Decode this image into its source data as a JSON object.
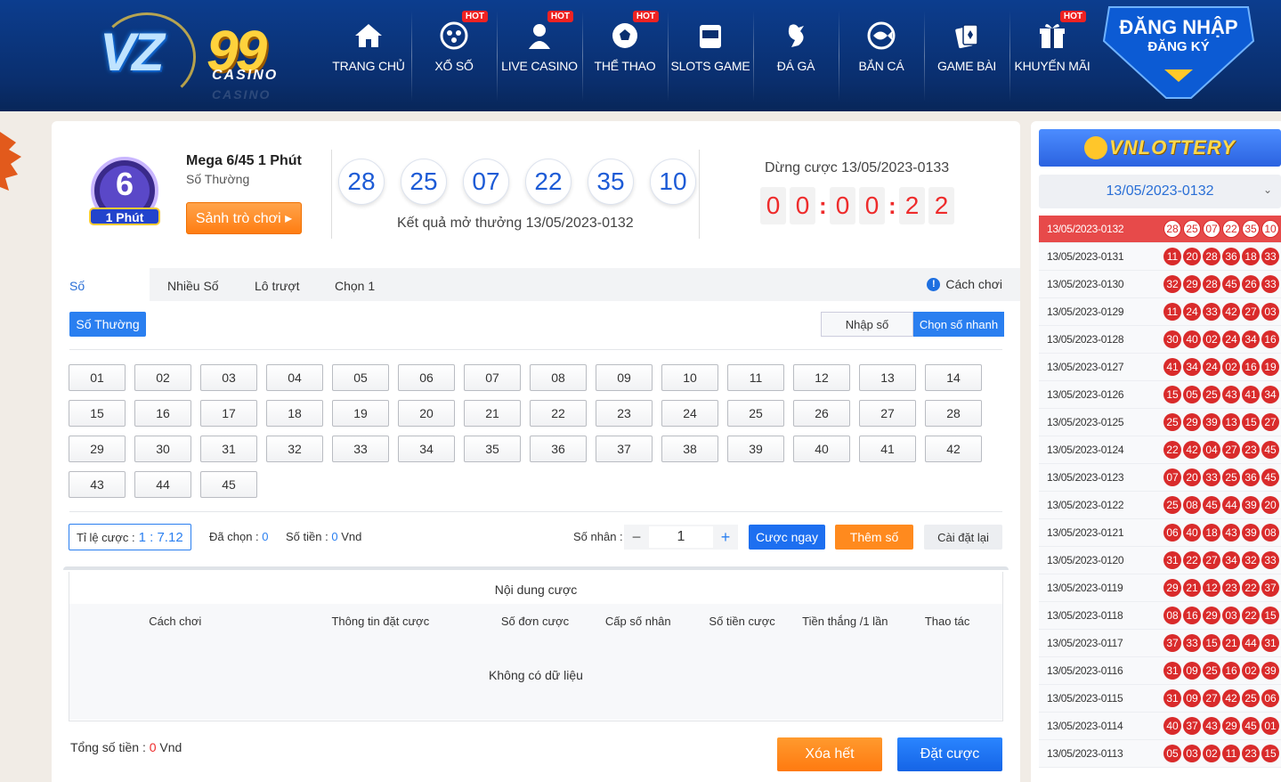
{
  "header": {
    "logo_text": "VZ99",
    "logo_sub": "CASINO",
    "nav": [
      {
        "label": "TRANG CHỦ",
        "icon": "home-icon",
        "hot": ""
      },
      {
        "label": "XỔ SỐ",
        "icon": "lottery-icon",
        "hot": "HOT"
      },
      {
        "label": "LIVE CASINO",
        "icon": "dealer-icon",
        "hot": "HOT"
      },
      {
        "label": "THỂ THAO",
        "icon": "soccer-ball-icon",
        "hot": "HOT"
      },
      {
        "label": "SLOTS GAME",
        "icon": "slot-machine-icon",
        "hot": ""
      },
      {
        "label": "ĐÁ GÀ",
        "icon": "rooster-icon",
        "hot": ""
      },
      {
        "label": "BẮN CÁ",
        "icon": "fish-icon",
        "hot": ""
      },
      {
        "label": "GAME BÀI",
        "icon": "cards-icon",
        "hot": ""
      },
      {
        "label": "KHUYẾN MÃI",
        "icon": "gift-icon",
        "hot": "HOT"
      }
    ],
    "login": "ĐĂNG NHẬP",
    "register": "ĐĂNG KÝ"
  },
  "game": {
    "logo_number": "6",
    "logo_label": "1 Phút",
    "name": "Mega 6/45 1 Phút",
    "type": "Số Thường",
    "lobby_button": "Sảnh trò chơi ▸",
    "last_result": [
      "28",
      "25",
      "07",
      "22",
      "35",
      "10"
    ],
    "result_caption": "Kết quả mở thưởng 13/05/2023-0132",
    "stop_label": "Dừng cược 13/05/2023-0133",
    "timer": [
      "0",
      "0",
      "0",
      "0",
      "2",
      "2"
    ]
  },
  "tabs": [
    "Số Thường",
    "Nhiều Số",
    "Lô trượt",
    "Chọn 1"
  ],
  "how_to_play": "Cách chơi",
  "mode_button": "Số Thường",
  "input_mode": {
    "manual": "Nhập số",
    "quick": "Chọn số nhanh"
  },
  "numbers": [
    "01",
    "02",
    "03",
    "04",
    "05",
    "06",
    "07",
    "08",
    "09",
    "10",
    "11",
    "12",
    "13",
    "14",
    "15",
    "16",
    "17",
    "18",
    "19",
    "20",
    "21",
    "22",
    "23",
    "24",
    "25",
    "26",
    "27",
    "28",
    "29",
    "30",
    "31",
    "32",
    "33",
    "34",
    "35",
    "36",
    "37",
    "38",
    "39",
    "40",
    "41",
    "42",
    "43",
    "44",
    "45"
  ],
  "bet": {
    "odds_label": "Tỉ lệ cược :",
    "odds_value": "1 : 7.12",
    "selected_label": "Đã chọn :",
    "selected_value": "0",
    "amount_label": "Số tiền :",
    "amount_value": "0",
    "currency": "Vnd",
    "multiplier_label": "Số nhân :",
    "multiplier_value": "1",
    "bet_now": "Cược ngay",
    "add_number": "Thêm số",
    "reset": "Cài đặt lại"
  },
  "bet_table": {
    "title": "Nội dung cược",
    "columns": [
      "Cách chơi",
      "Thông tin đặt cược",
      "Số đơn cược",
      "Cấp số nhân",
      "Số tiền cược",
      "Tiền thắng /1 lần",
      "Thao tác"
    ],
    "empty": "Không có dữ liệu"
  },
  "footer": {
    "total_label": "Tổng số tiền :",
    "total_value": "0",
    "currency": "Vnd",
    "clear": "Xóa hết",
    "place": "Đặt cược"
  },
  "side": {
    "brand": "VNLOTTERY",
    "selected_date": "13/05/2023-0132",
    "history": [
      {
        "code": "13/05/2023-0132",
        "balls": [
          "28",
          "25",
          "07",
          "22",
          "35",
          "10"
        ]
      },
      {
        "code": "13/05/2023-0131",
        "balls": [
          "11",
          "20",
          "28",
          "36",
          "18",
          "33"
        ]
      },
      {
        "code": "13/05/2023-0130",
        "balls": [
          "32",
          "29",
          "28",
          "45",
          "26",
          "33"
        ]
      },
      {
        "code": "13/05/2023-0129",
        "balls": [
          "11",
          "24",
          "33",
          "42",
          "27",
          "03"
        ]
      },
      {
        "code": "13/05/2023-0128",
        "balls": [
          "30",
          "40",
          "02",
          "24",
          "34",
          "16"
        ]
      },
      {
        "code": "13/05/2023-0127",
        "balls": [
          "41",
          "34",
          "24",
          "02",
          "16",
          "19"
        ]
      },
      {
        "code": "13/05/2023-0126",
        "balls": [
          "15",
          "05",
          "25",
          "43",
          "41",
          "34"
        ]
      },
      {
        "code": "13/05/2023-0125",
        "balls": [
          "25",
          "29",
          "39",
          "13",
          "15",
          "27"
        ]
      },
      {
        "code": "13/05/2023-0124",
        "balls": [
          "22",
          "42",
          "04",
          "27",
          "23",
          "45"
        ]
      },
      {
        "code": "13/05/2023-0123",
        "balls": [
          "07",
          "20",
          "33",
          "25",
          "36",
          "45"
        ]
      },
      {
        "code": "13/05/2023-0122",
        "balls": [
          "25",
          "08",
          "45",
          "44",
          "39",
          "20"
        ]
      },
      {
        "code": "13/05/2023-0121",
        "balls": [
          "06",
          "40",
          "18",
          "43",
          "39",
          "08"
        ]
      },
      {
        "code": "13/05/2023-0120",
        "balls": [
          "31",
          "22",
          "27",
          "34",
          "32",
          "33"
        ]
      },
      {
        "code": "13/05/2023-0119",
        "balls": [
          "29",
          "21",
          "12",
          "23",
          "22",
          "37"
        ]
      },
      {
        "code": "13/05/2023-0118",
        "balls": [
          "08",
          "16",
          "29",
          "03",
          "22",
          "15"
        ]
      },
      {
        "code": "13/05/2023-0117",
        "balls": [
          "37",
          "33",
          "15",
          "21",
          "44",
          "31"
        ]
      },
      {
        "code": "13/05/2023-0116",
        "balls": [
          "31",
          "09",
          "25",
          "16",
          "02",
          "39"
        ]
      },
      {
        "code": "13/05/2023-0115",
        "balls": [
          "31",
          "09",
          "27",
          "42",
          "25",
          "06"
        ]
      },
      {
        "code": "13/05/2023-0114",
        "balls": [
          "40",
          "37",
          "43",
          "29",
          "45",
          "01"
        ]
      },
      {
        "code": "13/05/2023-0113",
        "balls": [
          "05",
          "03",
          "02",
          "11",
          "23",
          "15"
        ]
      }
    ]
  }
}
